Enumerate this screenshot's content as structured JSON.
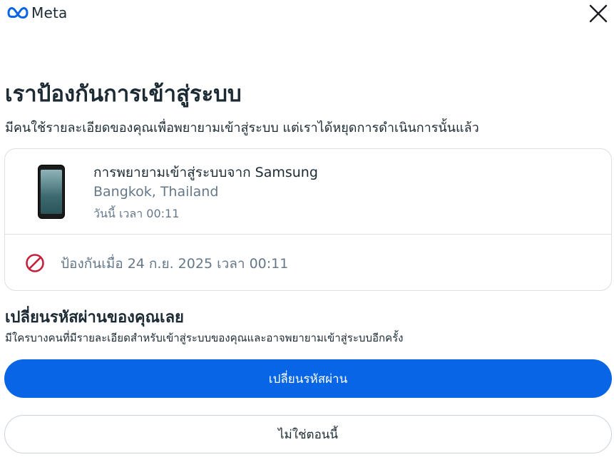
{
  "header": {
    "logo_text": "Meta",
    "logo_icon": "meta-infinity-icon",
    "close_icon": "close-icon"
  },
  "main": {
    "title": "เราป้องกันการเข้าสู่ระบบ",
    "subtitle": "มีคนใช้รายละเอียดของคุณเพื่อพยายามเข้าสู่ระบบ แต่เราได้หยุดการดำเนินการนั้นแล้ว"
  },
  "login_card": {
    "device_icon": "smartphone-icon",
    "device_name": "การพยายามเข้าสู่ระบบจาก Samsung",
    "location": "Bangkok, Thailand",
    "time": "วันนี้ เวลา 00:11",
    "blocked_icon": "blocked-icon",
    "blocked_text": "ป้องกันเมื่อ 24 ก.ย. 2025 เวลา 00:11"
  },
  "change_password": {
    "title": "เปลี่ยนรหัสผ่านของคุณเลย",
    "description": "มีใครบางคนที่มีรายละเอียดสำหรับเข้าสู่ระบบของคุณและอาจพยายามเข้าสู่ระบบอีกครั้ง",
    "primary_button": "เปลี่ยนรหัสผ่าน",
    "secondary_button": "ไม่ใช่ตอนนี้"
  },
  "colors": {
    "primary": "#0866e6",
    "text": "#1c2b33",
    "secondary_text": "#65788a",
    "blocked_red": "#c5213d",
    "border": "#dddfe2"
  }
}
